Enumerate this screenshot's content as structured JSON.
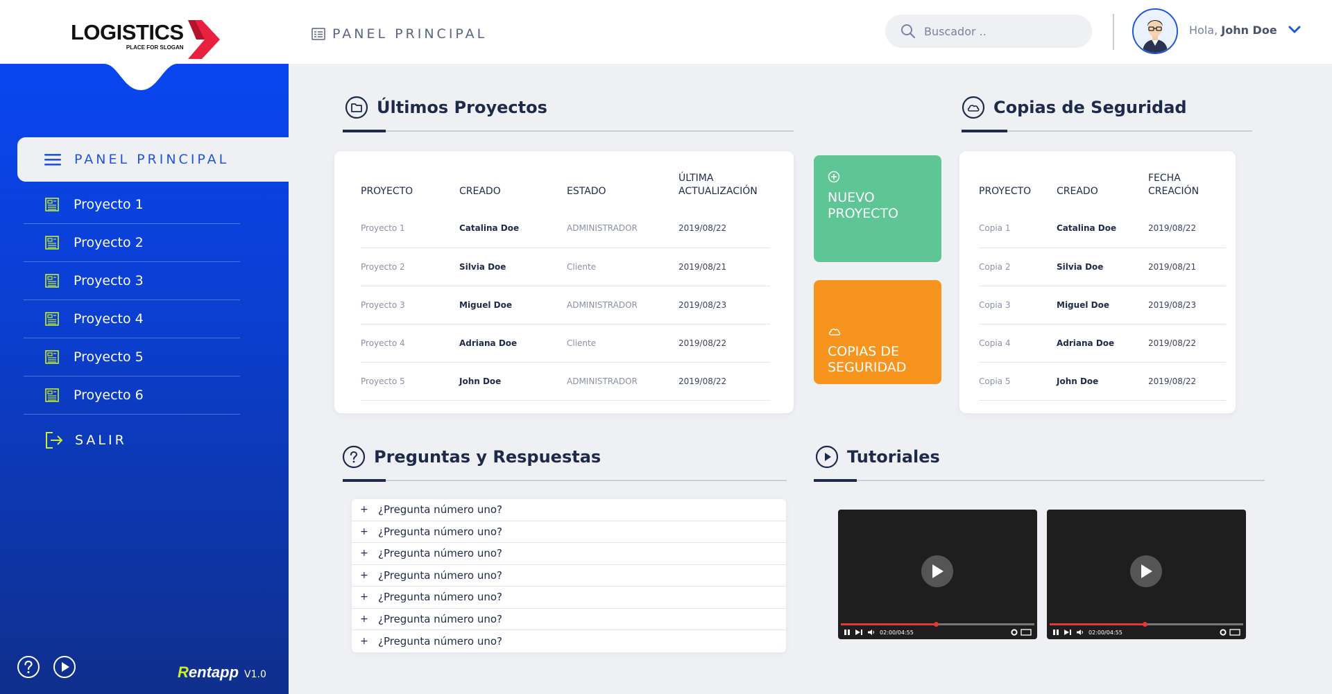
{
  "brand": {
    "title": "LOGISTICS",
    "slogan": "PLACE FOR SLOGAN"
  },
  "header": {
    "title": "PANEL PRINCIPAL",
    "search_placeholder": "Buscador ..",
    "greeting": "Hola,",
    "user_name": "John Doe"
  },
  "sidebar": {
    "active_label": "PANEL PRINCIPAL",
    "items": [
      {
        "label": "Proyecto 1"
      },
      {
        "label": "Proyecto 2"
      },
      {
        "label": "Proyecto 3"
      },
      {
        "label": "Proyecto 4"
      },
      {
        "label": "Proyecto 5"
      },
      {
        "label": "Proyecto 6"
      }
    ],
    "logout_label": "SALIR",
    "footer_brand": "entapp",
    "footer_brand_initial": "R",
    "version": "V1.0"
  },
  "projects": {
    "title": "Últimos Proyectos",
    "headers": [
      "PROYECTO",
      "CREADO",
      "ESTADO",
      "ÚLTIMA ACTUALIZACIÓN"
    ],
    "rows": [
      {
        "project": "Proyecto 1",
        "creator": "Catalina Doe",
        "status": "ADMINISTRADOR",
        "date": "2019/08/22"
      },
      {
        "project": "Proyecto 2",
        "creator": "Silvia Doe",
        "status": "Cliente",
        "date": "2019/08/21"
      },
      {
        "project": "Proyecto 3",
        "creator": "Miguel Doe",
        "status": "ADMINISTRADOR",
        "date": "2019/08/23"
      },
      {
        "project": "Proyecto 4",
        "creator": "Adriana Doe",
        "status": "Cliente",
        "date": "2019/08/22"
      },
      {
        "project": "Proyecto 5",
        "creator": "John Doe",
        "status": "ADMINISTRADOR",
        "date": "2019/08/22"
      }
    ]
  },
  "tiles": {
    "new_project": "NUEVO PROYECTO",
    "backups": "COPIAS DE SEGURIDAD",
    "new_project_color": "#5ec595",
    "backups_color": "#f7941d"
  },
  "backups": {
    "title": "Copias de Seguridad",
    "headers": [
      "PROYECTO",
      "CREADO",
      "FECHA CREACIÓN"
    ],
    "rows": [
      {
        "copy": "Copia 1",
        "creator": "Catalina Doe",
        "date": "2019/08/22"
      },
      {
        "copy": "Copia 2",
        "creator": "Silvia Doe",
        "date": "2019/08/21"
      },
      {
        "copy": "Copia 3",
        "creator": "Miguel Doe",
        "date": "2019/08/23"
      },
      {
        "copy": "Copia 4",
        "creator": "Adriana Doe",
        "date": "2019/08/22"
      },
      {
        "copy": "Copia 5",
        "creator": "John Doe",
        "date": "2019/08/22"
      }
    ]
  },
  "faq": {
    "title": "Preguntas y Respuestas",
    "expand_symbol": "+",
    "items": [
      "¿Pregunta número uno?",
      "¿Pregunta número uno?",
      "¿Pregunta número uno?",
      "¿Pregunta número uno?",
      "¿Pregunta número uno?",
      "¿Pregunta número uno?",
      "¿Pregunta número uno?"
    ]
  },
  "tutorials": {
    "title": "Tutoriales",
    "videos": [
      {
        "time": "02:00/04:55",
        "progress": 0.49
      },
      {
        "time": "02:00/04:55",
        "progress": 0.49
      }
    ]
  },
  "colors": {
    "accent": "#1f55d6",
    "sidebar_top": "#0a46f0",
    "sidebar_bottom": "#0f2f8c",
    "icon_green": "#c8f02a",
    "text_dark": "#1e2a4a",
    "logo_red": "#e8213f"
  }
}
